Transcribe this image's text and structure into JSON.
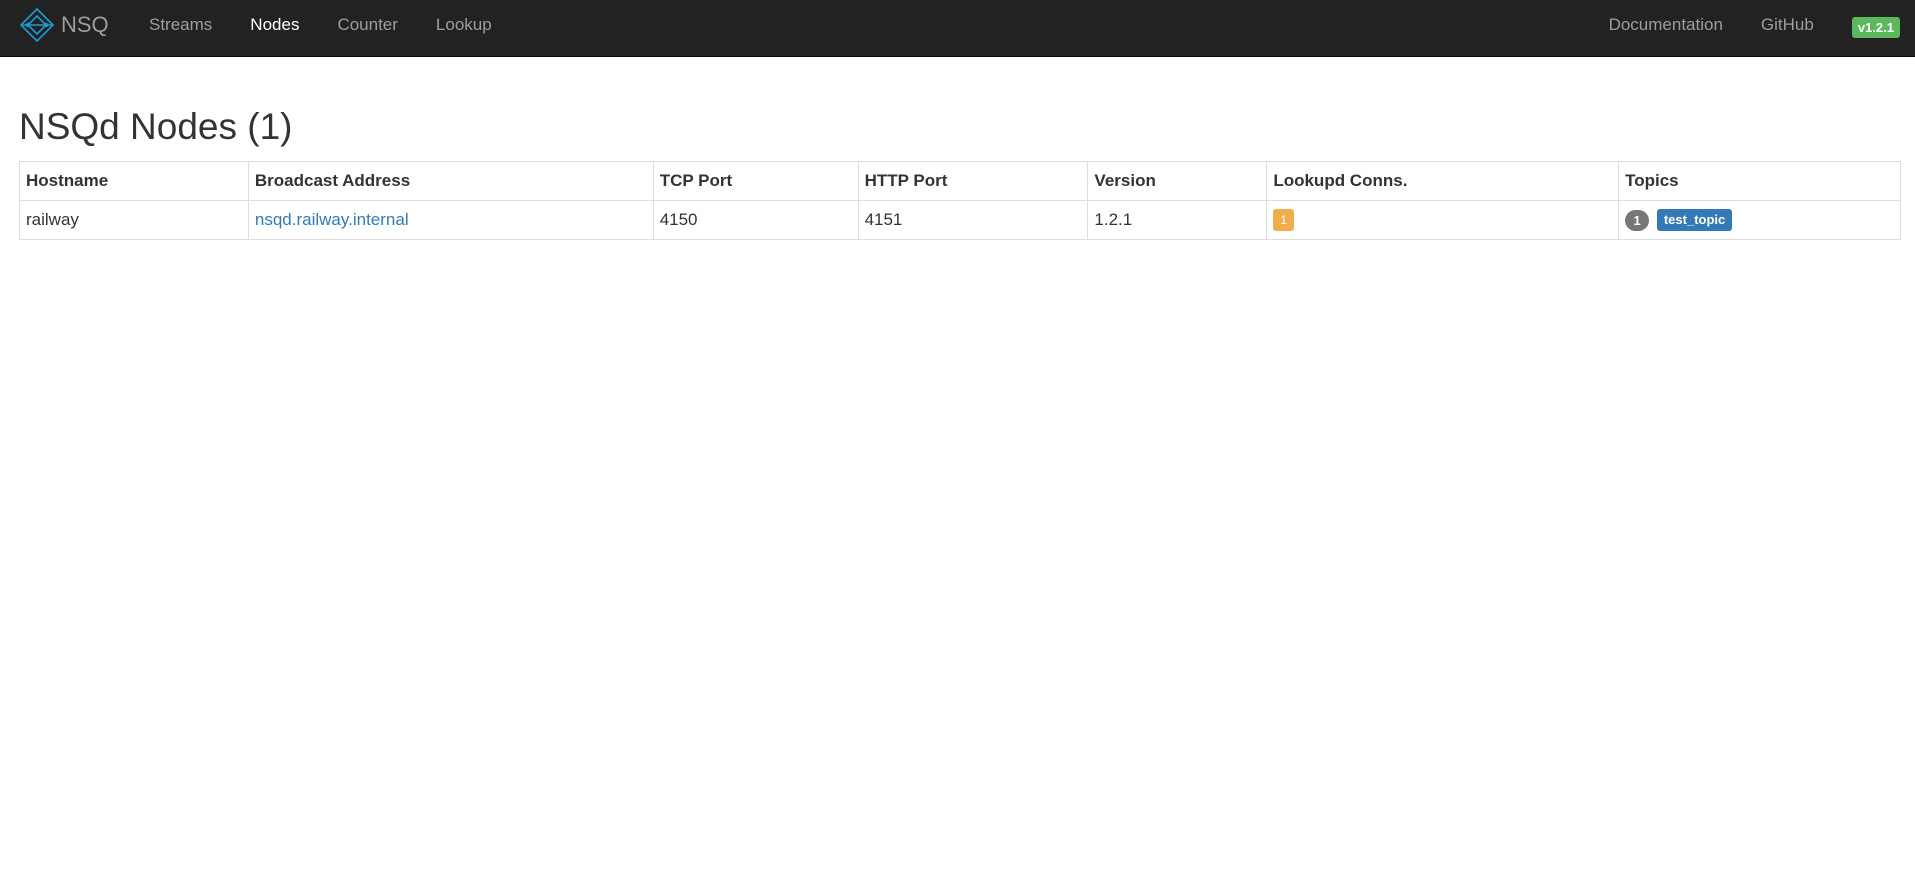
{
  "navbar": {
    "brand": "NSQ",
    "links": [
      {
        "label": "Streams",
        "active": false
      },
      {
        "label": "Nodes",
        "active": true
      },
      {
        "label": "Counter",
        "active": false
      },
      {
        "label": "Lookup",
        "active": false
      }
    ],
    "right_links": [
      {
        "label": "Documentation"
      },
      {
        "label": "GitHub"
      }
    ],
    "version": "v1.2.1"
  },
  "page": {
    "title": "NSQd Nodes (1)"
  },
  "table": {
    "columns": [
      "Hostname",
      "Broadcast Address",
      "TCP Port",
      "HTTP Port",
      "Version",
      "Lookupd Conns.",
      "Topics"
    ],
    "rows": [
      {
        "hostname": "railway",
        "broadcast_address": "nsqd.railway.internal",
        "tcp_port": "4150",
        "http_port": "4151",
        "version": "1.2.1",
        "lookupd_conns": "1",
        "topic_count": "1",
        "topics": [
          "test_topic"
        ]
      }
    ]
  },
  "colors": {
    "navbar_bg": "#222222",
    "link": "#337ab7",
    "version_badge": "#5cb85c",
    "warning_badge": "#f0ad4e",
    "count_badge": "#777777",
    "topic_label": "#337ab7"
  },
  "icons": {
    "brand_logo": "nsq-logo-icon"
  }
}
